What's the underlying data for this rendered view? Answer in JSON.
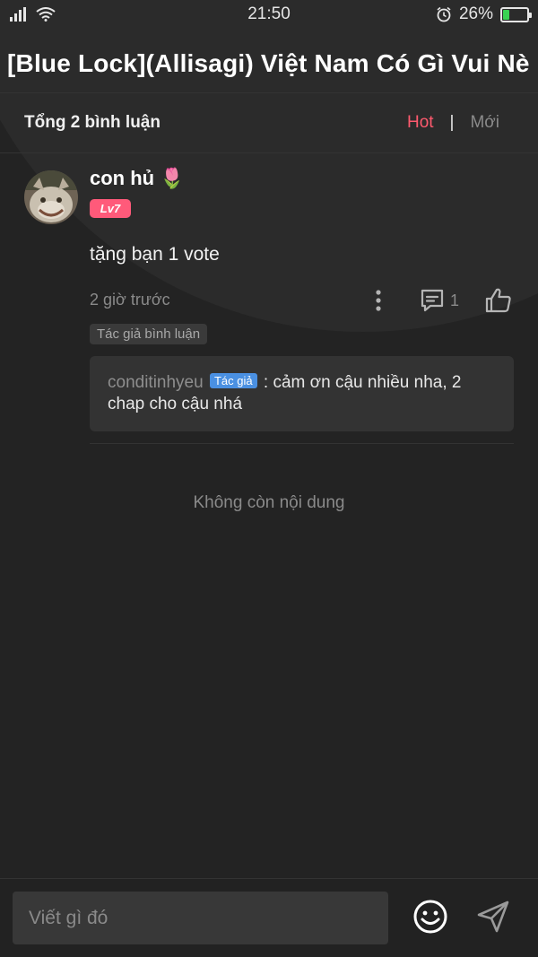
{
  "status_bar": {
    "time": "21:50",
    "battery_percent": "26%",
    "battery_level": 0.26,
    "battery_color": "#39d353"
  },
  "header": {
    "title": "[Blue Lock](Allisagi) Việt Nam Có Gì Vui Nè"
  },
  "comments_summary": {
    "total_label": "Tổng 2 bình luận",
    "sort_hot": "Hot",
    "sort_separator": "|",
    "sort_new": "Mới",
    "active_sort_color": "#ff5a6e"
  },
  "comment": {
    "username": "con hủ",
    "username_emoji": "🌷",
    "level": "Lv7",
    "text": "tặng bạn 1 vote",
    "time": "2 giờ trước",
    "reply_count": "1",
    "author_tag": "Tác giả bình luận",
    "reply": {
      "user": "conditinhyeu",
      "badge": "Tác giả",
      "text": ": cảm ơn cậu nhiều nha, 2 chap cho cậu nhá"
    }
  },
  "end_message": "Không còn nội dung",
  "composer": {
    "placeholder": "Viết gì đó"
  },
  "icons": {
    "signal": "signal-icon",
    "wifi": "wifi-icon",
    "alarm": "alarm-icon",
    "battery": "battery-icon",
    "more": "more-vertical-icon",
    "reply": "comment-icon",
    "like": "thumbs-up-icon",
    "emoji": "emoji-icon",
    "send": "send-icon"
  }
}
